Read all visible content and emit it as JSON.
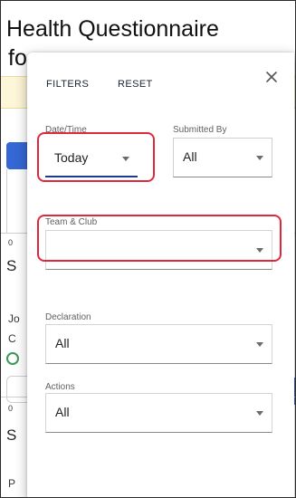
{
  "page": {
    "title": "Health Questionnaire",
    "title_line2_fragment": "fo",
    "list_fragments": [
      "0",
      "S",
      "Jo",
      "C",
      "0",
      "S",
      "P"
    ]
  },
  "filters": {
    "header_label": "FILTERS",
    "reset_label": "RESET",
    "close_icon": "close-icon",
    "fields": {
      "date_time": {
        "label": "Date/Time",
        "value": "Today"
      },
      "submitted_by": {
        "label": "Submitted By",
        "value": "All"
      },
      "team_club": {
        "label": "Team & Club",
        "value": ""
      },
      "declaration": {
        "label": "Declaration",
        "value": "All"
      },
      "actions": {
        "label": "Actions",
        "value": "All"
      }
    }
  },
  "colors": {
    "highlight": "#e0283c",
    "primary": "#3568d4",
    "focus_underline": "#1c3b8f",
    "banner": "#fdf6d8"
  }
}
